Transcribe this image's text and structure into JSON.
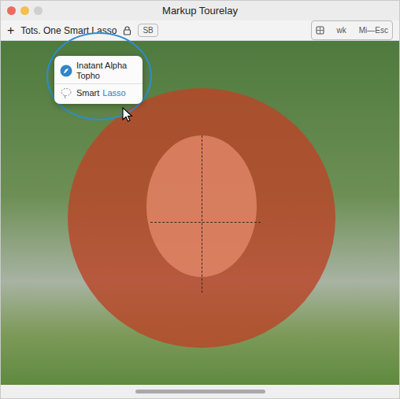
{
  "window": {
    "title": "Markup Tourelay"
  },
  "toolbar": {
    "add": "+",
    "label": "Tots. One Smart Lasso",
    "badge": "SB",
    "right": [
      "wk",
      "Mi—Esc"
    ]
  },
  "menu": {
    "items": [
      {
        "label": "Inatant Alpha Topho",
        "kind": "app"
      },
      {
        "label": "Smart",
        "accent": "Lasso",
        "kind": "tool"
      }
    ]
  }
}
